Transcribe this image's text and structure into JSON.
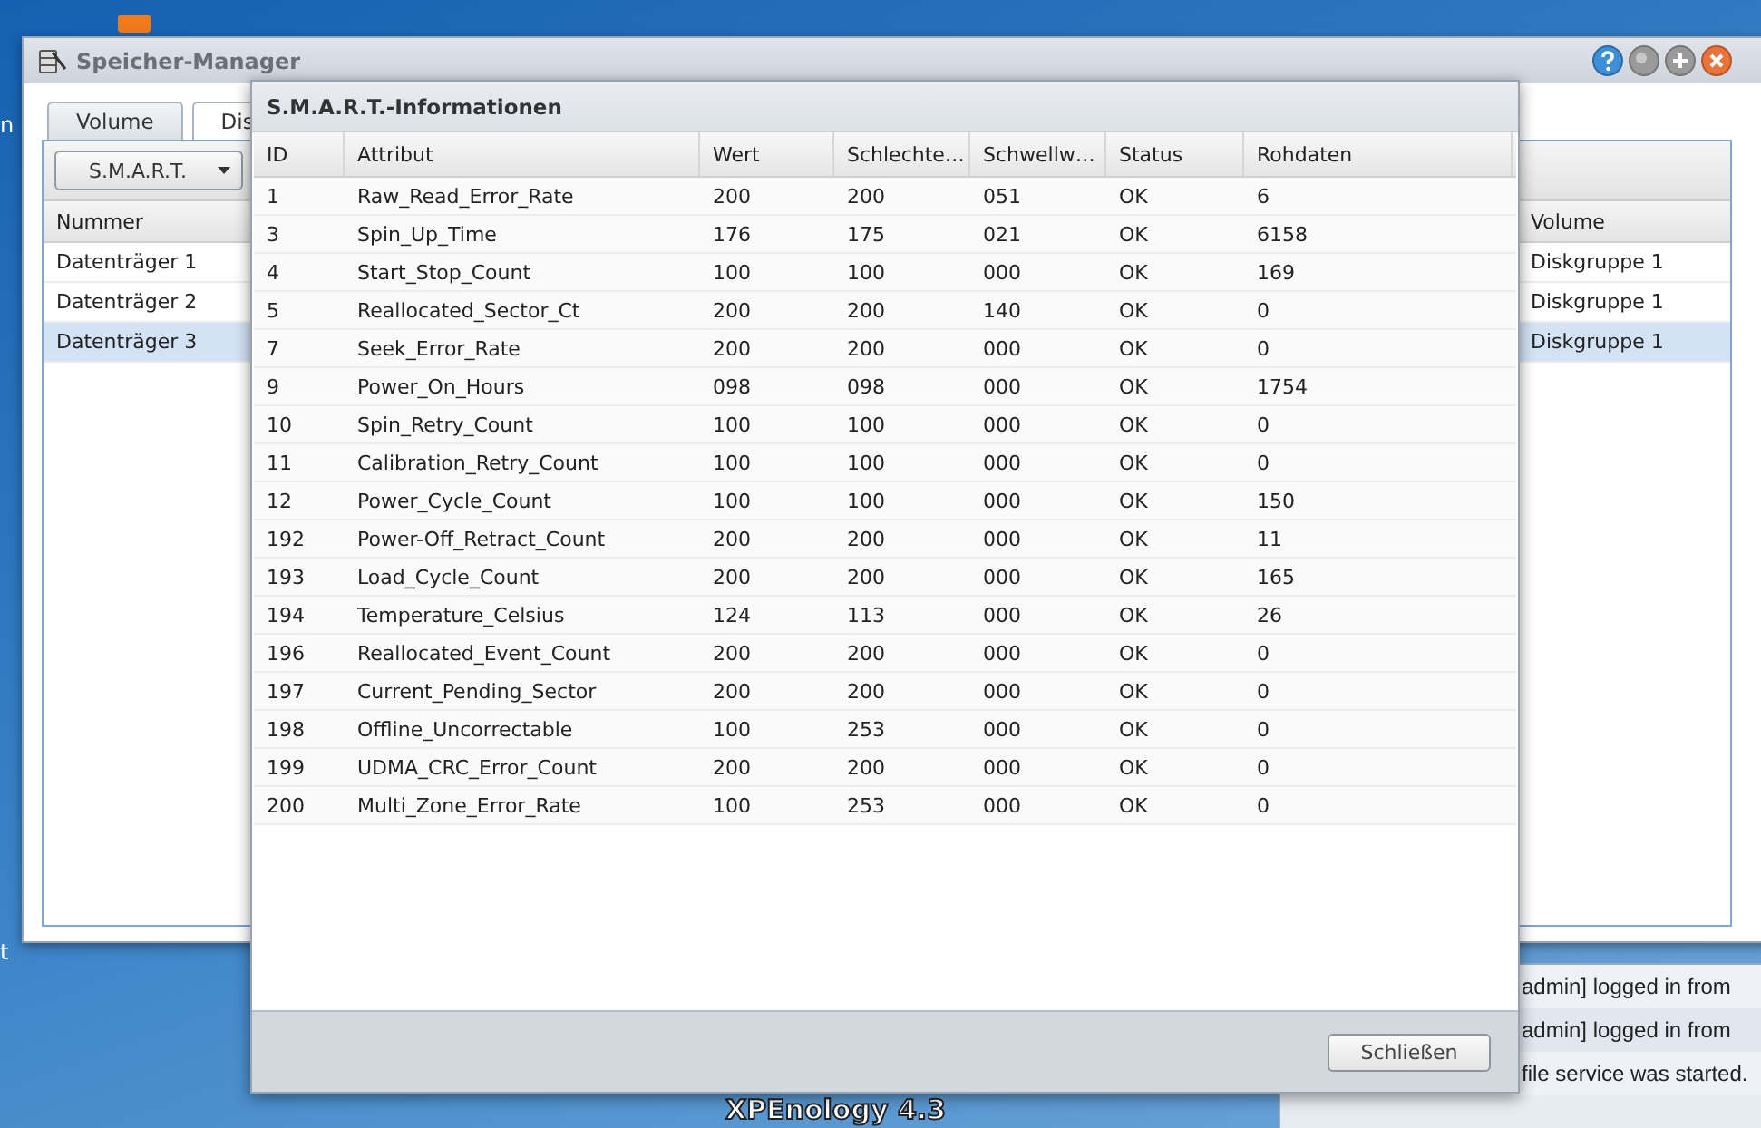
{
  "desktop": {
    "side_texts": [
      "n",
      "t"
    ],
    "brand": "XPEnology 4.3"
  },
  "log_panel": {
    "lines": [
      "admin] logged in from",
      "admin] logged in from",
      "file service was started."
    ]
  },
  "window": {
    "title": "Speicher-Manager",
    "tabs": [
      {
        "label": "Volume",
        "selected": false
      },
      {
        "label": "Dis",
        "selected": true
      }
    ],
    "smart_button": "S.M.A.R.T.",
    "disk_table": {
      "columns": [
        "Nummer",
        "Volume"
      ],
      "rows": [
        {
          "number": "Datenträger 1",
          "volume": "Diskgruppe 1",
          "selected": false
        },
        {
          "number": "Datenträger 2",
          "volume": "Diskgruppe 1",
          "selected": false
        },
        {
          "number": "Datenträger 3",
          "volume": "Diskgruppe 1",
          "selected": true
        }
      ]
    }
  },
  "dialog": {
    "title": "S.M.A.R.T.-Informationen",
    "columns": [
      "ID",
      "Attribut",
      "Wert",
      "Schlechte…",
      "Schwellw…",
      "Status",
      "Rohdaten"
    ],
    "rows": [
      [
        "1",
        "Raw_Read_Error_Rate",
        "200",
        "200",
        "051",
        "OK",
        "6"
      ],
      [
        "3",
        "Spin_Up_Time",
        "176",
        "175",
        "021",
        "OK",
        "6158"
      ],
      [
        "4",
        "Start_Stop_Count",
        "100",
        "100",
        "000",
        "OK",
        "169"
      ],
      [
        "5",
        "Reallocated_Sector_Ct",
        "200",
        "200",
        "140",
        "OK",
        "0"
      ],
      [
        "7",
        "Seek_Error_Rate",
        "200",
        "200",
        "000",
        "OK",
        "0"
      ],
      [
        "9",
        "Power_On_Hours",
        "098",
        "098",
        "000",
        "OK",
        "1754"
      ],
      [
        "10",
        "Spin_Retry_Count",
        "100",
        "100",
        "000",
        "OK",
        "0"
      ],
      [
        "11",
        "Calibration_Retry_Count",
        "100",
        "100",
        "000",
        "OK",
        "0"
      ],
      [
        "12",
        "Power_Cycle_Count",
        "100",
        "100",
        "000",
        "OK",
        "150"
      ],
      [
        "192",
        "Power-Off_Retract_Count",
        "200",
        "200",
        "000",
        "OK",
        "11"
      ],
      [
        "193",
        "Load_Cycle_Count",
        "200",
        "200",
        "000",
        "OK",
        "165"
      ],
      [
        "194",
        "Temperature_Celsius",
        "124",
        "113",
        "000",
        "OK",
        "26"
      ],
      [
        "196",
        "Reallocated_Event_Count",
        "200",
        "200",
        "000",
        "OK",
        "0"
      ],
      [
        "197",
        "Current_Pending_Sector",
        "200",
        "200",
        "000",
        "OK",
        "0"
      ],
      [
        "198",
        "Offline_Uncorrectable",
        "100",
        "253",
        "000",
        "OK",
        "0"
      ],
      [
        "199",
        "UDMA_CRC_Error_Count",
        "200",
        "200",
        "000",
        "OK",
        "0"
      ],
      [
        "200",
        "Multi_Zone_Error_Rate",
        "100",
        "253",
        "000",
        "OK",
        "0"
      ]
    ],
    "close_button": "Schließen"
  }
}
